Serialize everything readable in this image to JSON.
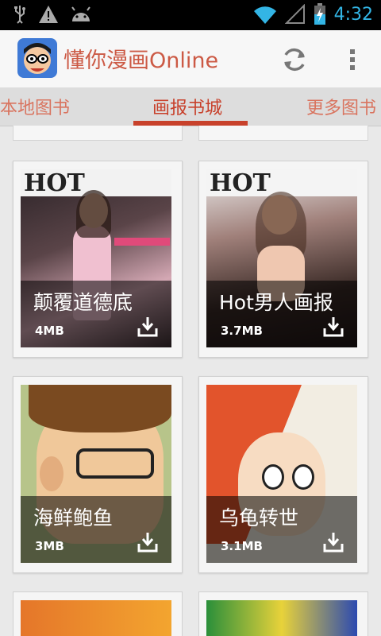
{
  "status_bar": {
    "time": "4:32",
    "icons": [
      "usb-icon",
      "warning-icon",
      "android-icon",
      "wifi-icon",
      "signal-icon",
      "battery-charging-icon"
    ]
  },
  "action_bar": {
    "title": "懂你漫画Online",
    "icons": [
      "app-logo-icon",
      "refresh-icon",
      "overflow-menu-icon"
    ]
  },
  "tabs": [
    {
      "label": "本地图书",
      "active": false
    },
    {
      "label": "画报书城",
      "active": true
    },
    {
      "label": "更多图书",
      "active": false
    }
  ],
  "books": [
    {
      "title": "颠覆道德底",
      "size": "4MB"
    },
    {
      "title": "Hot男人画报",
      "size": "3.7MB"
    },
    {
      "title": "海鲜鲍鱼",
      "size": "3MB"
    },
    {
      "title": "乌龟转世",
      "size": "3.1MB"
    }
  ],
  "colors": {
    "accent": "#c8412b",
    "title": "#cc5a45",
    "status_blue": "#33b5e5"
  }
}
